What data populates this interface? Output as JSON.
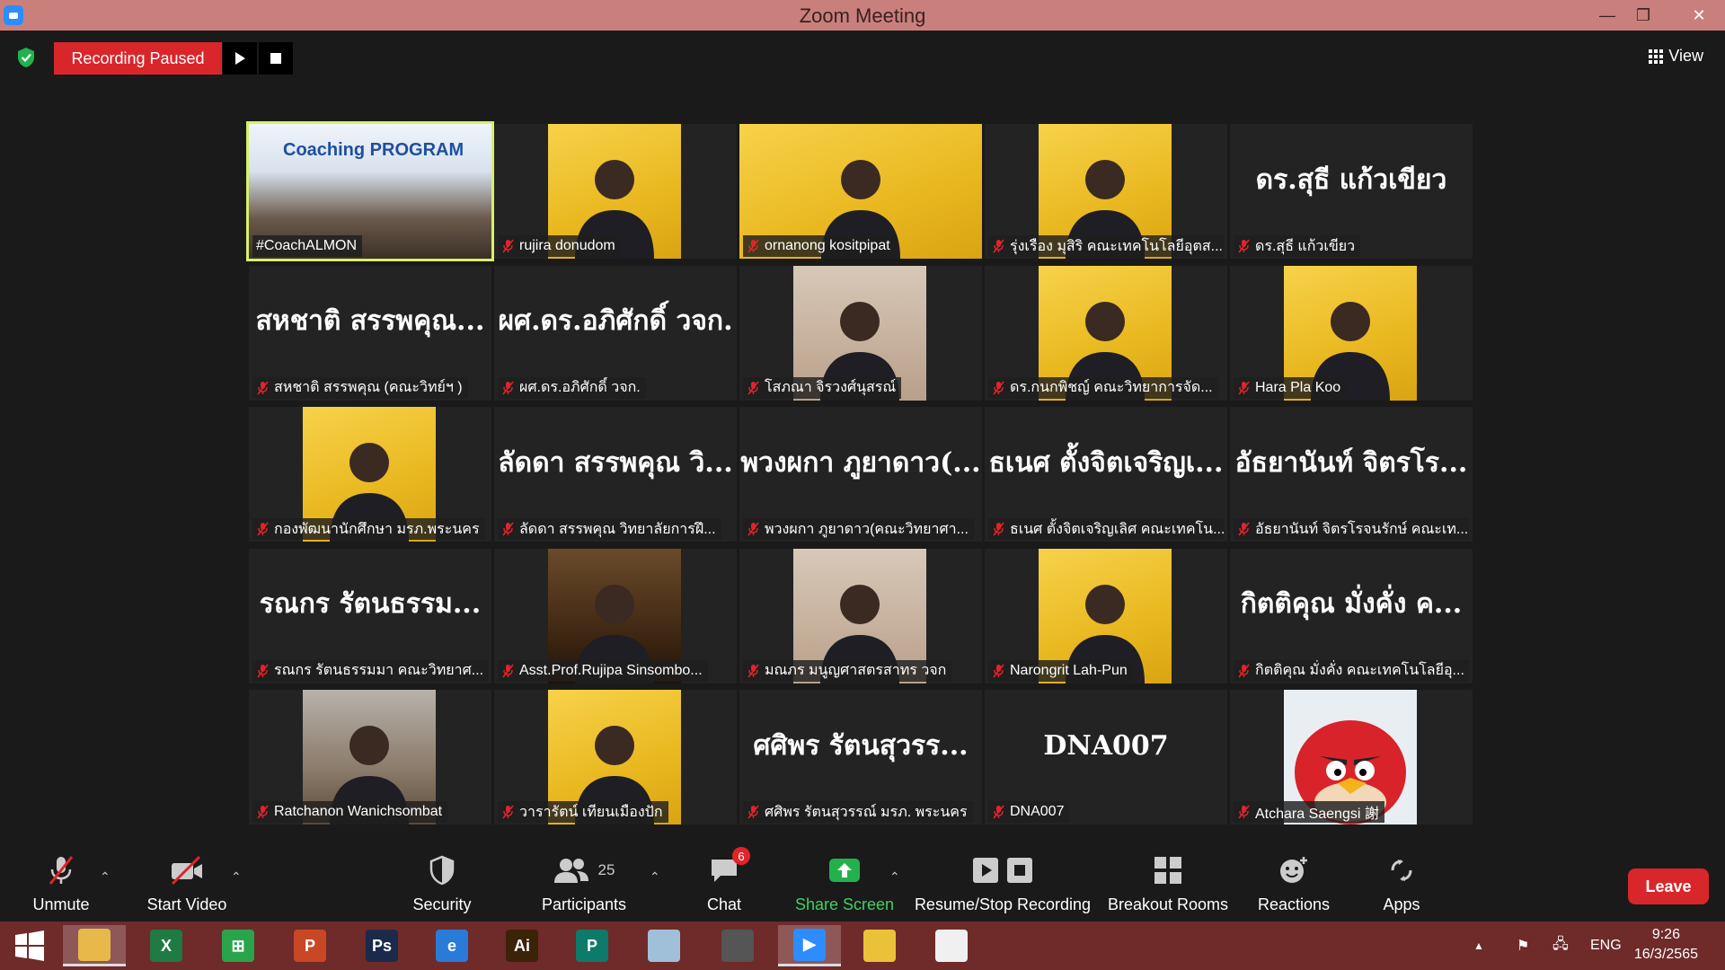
{
  "window": {
    "title": "Zoom Meeting",
    "controls": {
      "minimize": "—",
      "restore": "❐",
      "close": "✕"
    }
  },
  "topbar": {
    "recording_status": "Recording Paused",
    "resume_icon": "play-icon",
    "stop_icon": "stop-icon",
    "view_label": "View"
  },
  "tiles": [
    {
      "big": "",
      "label": "#CoachALMON",
      "muted": false,
      "active": true,
      "photo": "classroom",
      "photo_text": "Coaching PROGRAM"
    },
    {
      "big": "",
      "label": "rujira donudom",
      "muted": true,
      "photo": "yellow"
    },
    {
      "big": "",
      "label": "ornanong kositpipat",
      "muted": true,
      "photo": "yellow-wide"
    },
    {
      "big": "",
      "label": "รุ่งเรือง มุสิริ คณะเทคโนโลยีอุตส...",
      "muted": true,
      "photo": "yellow"
    },
    {
      "big": "ดร.สุธี แก้วเขียว",
      "label": "ดร.สุธี แก้วเขียว",
      "muted": true
    },
    {
      "big": "สหชาติ สรรพคุณ...",
      "label": "สหชาติ สรรพคุณ (คณะวิทย์ฯ )",
      "muted": true
    },
    {
      "big": "ผศ.ดร.อภิศักดิ์ วจก.",
      "label": "ผศ.ดร.อภิศักดิ์ วจก.",
      "muted": true
    },
    {
      "big": "",
      "label": "โสภณา จิรวงศ์นุสรณ์",
      "muted": true,
      "photo": "light"
    },
    {
      "big": "",
      "label": "ดร.กนกพิชญ์ คณะวิทยาการจัด...",
      "muted": true,
      "photo": "yellow"
    },
    {
      "big": "",
      "label": "Hara Pla Koo",
      "muted": true,
      "photo": "yellow"
    },
    {
      "big": "",
      "label": "กองพัฒนานักศึกษา มรภ.พระนคร",
      "muted": true,
      "photo": "yellow"
    },
    {
      "big": "ลัดดา สรรพคุณ วิ...",
      "label": "ลัดดา สรรพคุณ วิทยาลัยการฝึ...",
      "muted": true
    },
    {
      "big": "พวงผกา ภูยาดาว(...",
      "label": "พวงผกา ภูยาดาว(คณะวิทยาศา...",
      "muted": true
    },
    {
      "big": "ธเนศ ตั้งจิตเจริญเ...",
      "label": "ธเนศ ตั้งจิตเจริญเลิศ คณะเทคโน...",
      "muted": true
    },
    {
      "big": "อัธยานันท์ จิตรโร...",
      "label": "อัธยานันท์ จิตรโรจนรักษ์ คณะเท...",
      "muted": true
    },
    {
      "big": "รณกร รัตนธรรม...",
      "label": "รณกร รัตนธรรมมา คณะวิทยาศ...",
      "muted": true
    },
    {
      "big": "",
      "label": "Asst.Prof.Rujipa Sinsombo...",
      "muted": true,
      "photo": "brown"
    },
    {
      "big": "",
      "label": "มณภร มนูญศาสตรสาทร วจก",
      "muted": true,
      "photo": "light"
    },
    {
      "big": "",
      "label": "Narongrit Lah-Pun",
      "muted": true,
      "photo": "yellow"
    },
    {
      "big": "กิตติคุณ มั่งคั่ง ค...",
      "label": "กิตติคุณ มั่งคั่ง คณะเทคโนโลยีอุ...",
      "muted": true
    },
    {
      "big": "",
      "label": "Ratchanon Wanichsombat",
      "muted": true,
      "photo": "cafe"
    },
    {
      "big": "",
      "label": "วารารัตน์ เทียนเมืองปัก",
      "muted": true,
      "photo": "yellow"
    },
    {
      "big": "ศศิพร รัตนสุวรร...",
      "label": "ศศิพร รัตนสุวรรณ์ มรภ. พระนคร",
      "muted": true
    },
    {
      "big": "DNA007",
      "label": "DNA007",
      "muted": true
    },
    {
      "big": "",
      "label": "Atchara Saengsi 謝",
      "muted": true,
      "photo": "red"
    }
  ],
  "toolbar": {
    "unmute": "Unmute",
    "start_video": "Start Video",
    "security": "Security",
    "participants": "Participants",
    "participants_count": "25",
    "chat": "Chat",
    "chat_badge": "6",
    "share_screen": "Share Screen",
    "resume_stop": "Resume/Stop Recording",
    "breakout": "Breakout Rooms",
    "reactions": "Reactions",
    "apps": "Apps",
    "leave": "Leave"
  },
  "taskbar": {
    "apps": [
      {
        "name": "file-explorer-icon",
        "glyph": "",
        "color": "#e8b84a"
      },
      {
        "name": "excel-icon",
        "glyph": "X",
        "color": "#1f7a43"
      },
      {
        "name": "store-icon",
        "glyph": "⊞",
        "color": "#2aa44a"
      },
      {
        "name": "powerpoint-icon",
        "glyph": "P",
        "color": "#c84724"
      },
      {
        "name": "photoshop-icon",
        "glyph": "Ps",
        "color": "#1b2a4a"
      },
      {
        "name": "internet-explorer-icon",
        "glyph": "e",
        "color": "#2a7ad8"
      },
      {
        "name": "illustrator-icon",
        "glyph": "Ai",
        "color": "#3b2308"
      },
      {
        "name": "publisher-icon",
        "glyph": "P",
        "color": "#0e7a6a"
      },
      {
        "name": "notes-icon",
        "glyph": "",
        "color": "#9fc0d8"
      },
      {
        "name": "photoscape-icon",
        "glyph": "",
        "color": "#555555"
      },
      {
        "name": "zoom-icon",
        "glyph": "▶",
        "color": "#2d8cff"
      },
      {
        "name": "chrome-icon",
        "glyph": "",
        "color": "#e9c23a"
      },
      {
        "name": "slides-icon",
        "glyph": "",
        "color": "#f0f0f0"
      }
    ],
    "tray_lang": "ENG",
    "time": "9:26",
    "date": "16/3/2565"
  }
}
